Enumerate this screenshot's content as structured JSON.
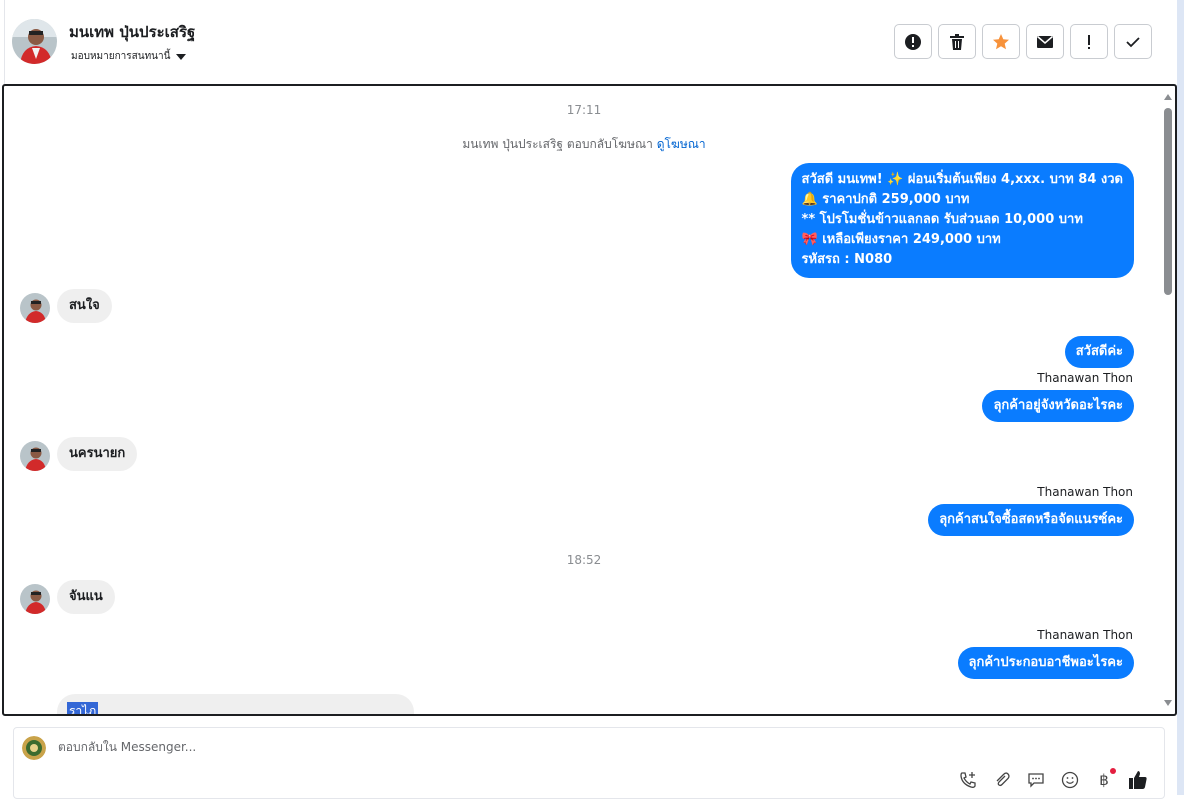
{
  "header": {
    "contact_name": "มนเทพ ปุ่นประเสริฐ",
    "assign_label": "มอบหมายการสนทนานี้",
    "actions": [
      {
        "icon": "alert-circle-icon",
        "glyph": "!"
      },
      {
        "icon": "trash-icon",
        "glyph": "🗑"
      },
      {
        "icon": "star-icon",
        "glyph": "★"
      },
      {
        "icon": "mail-icon",
        "glyph": "✉"
      },
      {
        "icon": "exclamation-icon",
        "glyph": "!"
      },
      {
        "icon": "check-icon",
        "glyph": "✓"
      }
    ]
  },
  "conversation": {
    "time_1": "17:11",
    "ad_notice_prefix": "มนเทพ ปุ่นประเสริฐ ตอบกลับโฆษณา",
    "ad_notice_link": "ดูโฆษณา",
    "promo_lines": [
      "สวัสดี มนเทพ! ✨  ผ่อนเริ่มต้นเพียง 4,xxx. บาท 84 งวด",
      "🔔 ราคาปกติ 259,000 บาท",
      "** โปรโมชั่นข้าวแลกลด รับส่วนลด 10,000 บาท",
      "🎀  เหลือเพียงราคา 249,000 บาท",
      " รหัสรถ : N080"
    ],
    "in_1": "สนใจ",
    "out_1": "สวัสดีค่ะ",
    "sender_1": "Thanawan Thon",
    "out_2": "ลุกค้าอยู่จังหวัดอะไรคะ",
    "in_2": "นครนายก",
    "sender_2": "Thanawan Thon",
    "out_3": "ลุกค้าสนใจซื้อสดหรือจัดแนรซ์คะ",
    "time_2": "18:52",
    "in_3": "จันแน",
    "sender_3": "Thanawan Thon",
    "out_4": "ลุกค้าประกอบอาชีพอะไรคะ",
    "partial_text": "ราไภ"
  },
  "composer": {
    "placeholder": "ตอบกลับใน Messenger...",
    "tools": [
      {
        "icon": "add-call-icon",
        "glyph": "☏"
      },
      {
        "icon": "attachment-icon",
        "glyph": "⌀"
      },
      {
        "icon": "saved-reply-icon",
        "glyph": "☐"
      },
      {
        "icon": "emoji-icon",
        "glyph": "☺"
      },
      {
        "icon": "baht-payment-icon",
        "glyph": "฿"
      },
      {
        "icon": "like-icon",
        "glyph": "👍"
      }
    ]
  },
  "colors": {
    "outgoing_bubble": "#0a7cff",
    "incoming_bubble": "#efefef",
    "star_accent": "#f7923b",
    "link": "#0064d1"
  }
}
